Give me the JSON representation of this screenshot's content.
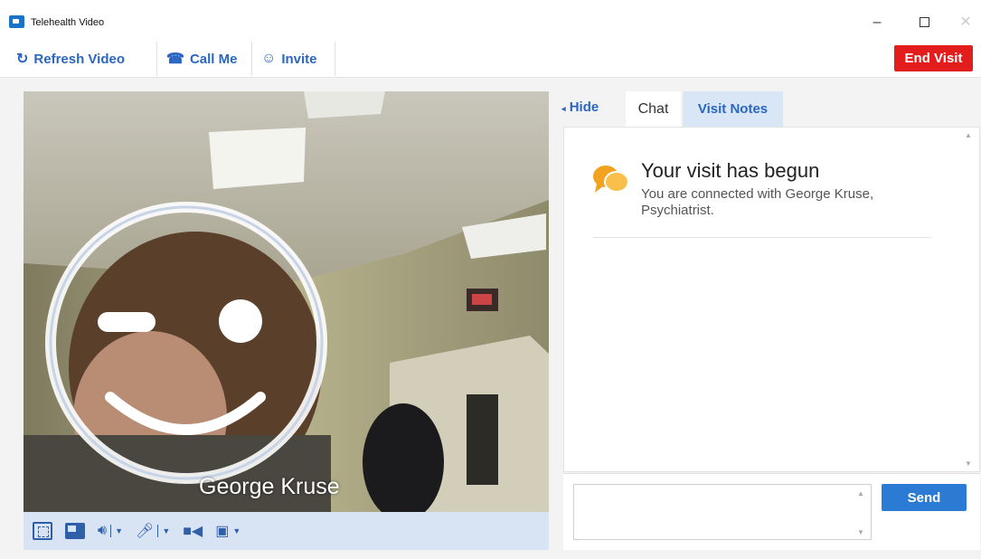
{
  "window": {
    "title": "Telehealth Video",
    "minimize_glyph": "–",
    "close_glyph": "✕"
  },
  "toolbar": {
    "refresh_label": "Refresh Video",
    "call_me_label": "Call Me",
    "invite_label": "Invite",
    "end_visit_label": "End Visit"
  },
  "video": {
    "caller_name": "George Kruse",
    "controls": [
      {
        "name": "fullscreen-icon"
      },
      {
        "name": "picture-in-picture-icon"
      },
      {
        "name": "speaker-icon"
      },
      {
        "name": "microphone-icon"
      },
      {
        "name": "camera-icon"
      },
      {
        "name": "camera-select-icon"
      }
    ]
  },
  "panel": {
    "hide_label": "Hide",
    "tabs": [
      {
        "label": "Chat",
        "active": true
      },
      {
        "label": "Visit Notes",
        "active": false
      }
    ],
    "message": {
      "title": "Your visit has begun",
      "body": "You are connected with George Kruse, Psychiatrist."
    },
    "input_placeholder": "",
    "send_label": "Send"
  },
  "colors": {
    "accent": "#2b66c2",
    "end_visit": "#e31c1c",
    "send": "#2b7bd4",
    "chat_icon": "#f5a623"
  }
}
